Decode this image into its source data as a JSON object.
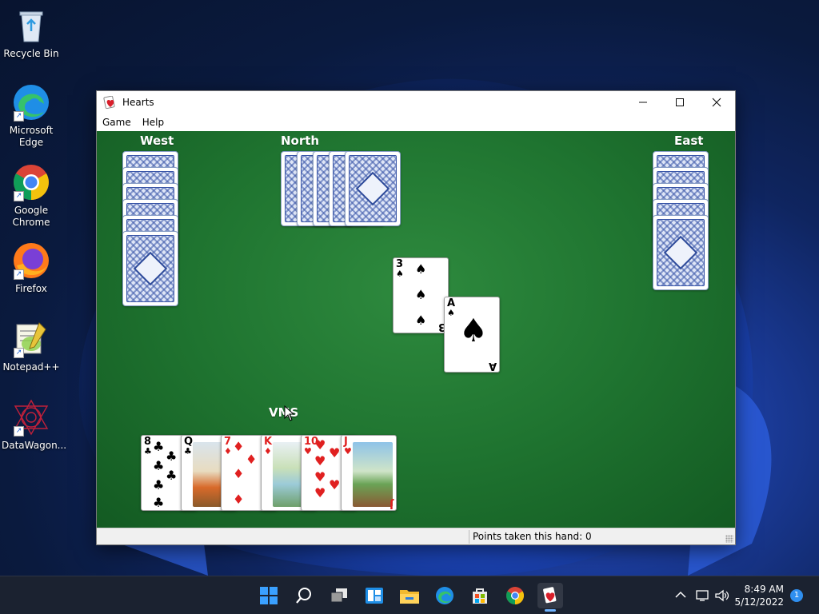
{
  "desktop": {
    "icons": [
      {
        "label": "Recycle Bin",
        "icon": "recycle-bin-icon"
      },
      {
        "label": "Microsoft Edge",
        "icon": "edge-icon"
      },
      {
        "label": "Google Chrome",
        "icon": "chrome-icon"
      },
      {
        "label": "Firefox",
        "icon": "firefox-icon"
      },
      {
        "label": "Notepad++",
        "icon": "notepadpp-icon"
      },
      {
        "label": "DataWagon...",
        "icon": "datawagon-icon"
      }
    ]
  },
  "window": {
    "title": "Hearts",
    "menu": [
      "Game",
      "Help"
    ],
    "status": "Points taken this hand: 0"
  },
  "game": {
    "players": {
      "west": "West",
      "north": "North",
      "east": "East",
      "south": "VMS"
    },
    "trick": [
      {
        "rank": "3",
        "suit": "♠",
        "color": "black"
      },
      {
        "rank": "A",
        "suit": "♠",
        "color": "black"
      }
    ],
    "hand": [
      {
        "rank": "8",
        "suit": "♣",
        "color": "black"
      },
      {
        "rank": "Q",
        "suit": "♣",
        "color": "black"
      },
      {
        "rank": "7",
        "suit": "♦",
        "color": "red"
      },
      {
        "rank": "K",
        "suit": "♦",
        "color": "red"
      },
      {
        "rank": "10",
        "suit": "♥",
        "color": "red"
      },
      {
        "rank": "J",
        "suit": "♥",
        "color": "red"
      }
    ]
  },
  "taskbar": {
    "apps": [
      "start-icon",
      "search-icon",
      "task-view-icon",
      "widgets-icon",
      "file-explorer-icon",
      "edge-icon",
      "store-icon",
      "chrome-icon",
      "hearts-icon"
    ],
    "time": "8:49 AM",
    "date": "5/12/2022",
    "notifications": "1"
  }
}
